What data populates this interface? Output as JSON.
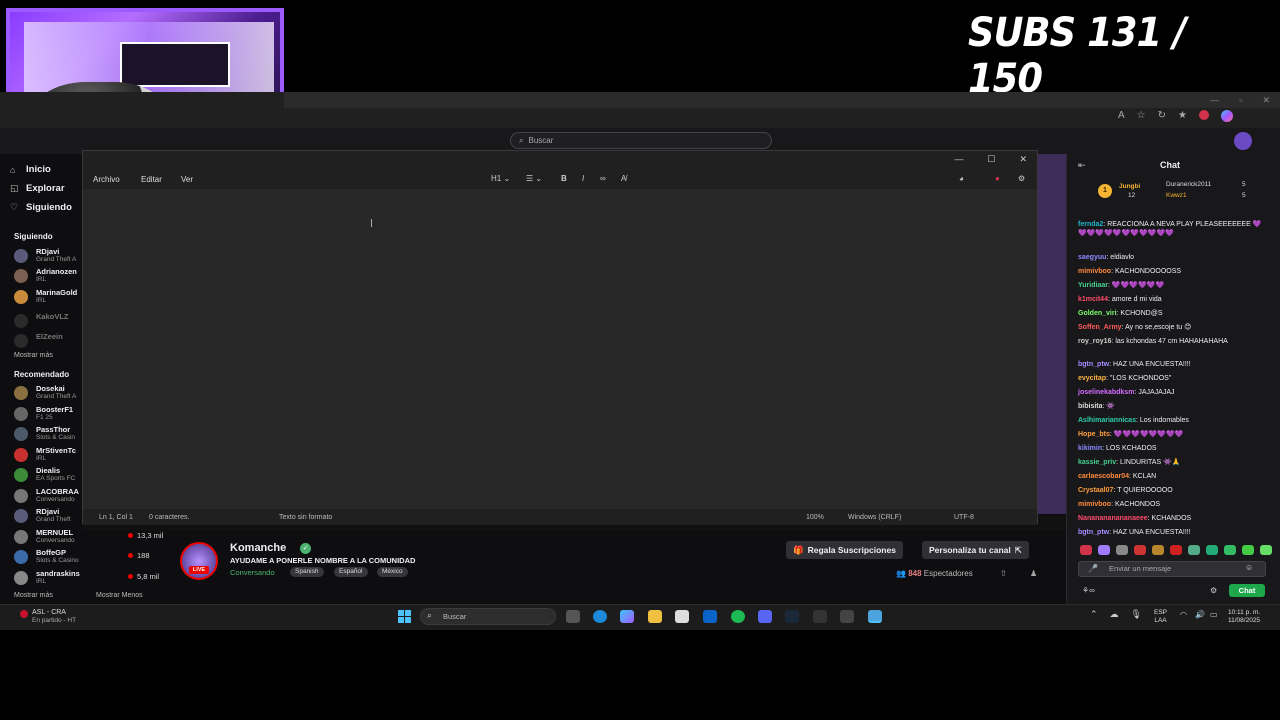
{
  "overlay": {
    "subs_counter": "SUBS 131 / 150"
  },
  "twitch": {
    "search_placeholder": "Buscar",
    "nav": {
      "inicio": "Inicio",
      "explorar": "Explorar",
      "siguiendo": "Siguiendo"
    },
    "following_title": "Siguiendo",
    "following": [
      {
        "name": "RDjavi",
        "game": "Grand Theft A"
      },
      {
        "name": "Adrianozen",
        "game": "IRL"
      },
      {
        "name": "MarinaGold",
        "game": "IRL"
      },
      {
        "name": "KakoVLZ",
        "game": ""
      },
      {
        "name": "ElZeein",
        "game": ""
      }
    ],
    "show_more_1": "Mostrar más",
    "recommended_title": "Recomendado",
    "recommended": [
      {
        "name": "Dosekai",
        "game": "Grand Theft A"
      },
      {
        "name": "BoosterF1",
        "game": "F1 25"
      },
      {
        "name": "PassThor",
        "game": "Slots & Casin"
      },
      {
        "name": "MrStivenTc",
        "game": "IRL"
      },
      {
        "name": "Diealis",
        "game": "EA Sports FC"
      },
      {
        "name": "LACOBRAA",
        "game": "Conversando"
      },
      {
        "name": "RDjavi",
        "game": "Grand Theft"
      },
      {
        "name": "MERNUEL",
        "game": "Conversando",
        "viewers": "13,3 mil"
      },
      {
        "name": "BoffeGP",
        "game": "Slots & Casino",
        "viewers": "188"
      },
      {
        "name": "sandraskins",
        "game": "IRL",
        "viewers": "5,8 mil"
      }
    ],
    "show_more_2": "Mostrar más",
    "show_less": "Mostrar Menos",
    "stream": {
      "streamer": "Komanche",
      "live": "LIVE",
      "title": "AYUDAME A PONERLE NOMBRE A LA COMUNIDAD",
      "category": "Conversando",
      "tags": [
        "Spanish",
        "Español",
        "México"
      ],
      "gift_button": "Regala Suscripciones",
      "customize_button": "Personaliza tu canal",
      "viewers_count": "848",
      "viewers_label": "Espectadores"
    },
    "chat": {
      "title": "Chat",
      "hype": {
        "rank": "1",
        "top_user": "Jungbi",
        "top_count": "12",
        "user2": "Duranerick2011",
        "user2_count": "5",
        "user3": "Kwwz1",
        "user3_count": "5"
      },
      "messages": [
        {
          "user": "fernda2",
          "color": "#1fb4c8",
          "text": "REACCIONA A NEVA PLAY PLEASEEEEEEE 💜💜💜💜💜💜💜💜💜💜💜💜"
        },
        {
          "user": "saegyuu",
          "color": "#8a8aff",
          "text": "eldiavlo"
        },
        {
          "user": "mimivboo",
          "color": "#ff8a3d",
          "text": "KACHONDOOOOSS"
        },
        {
          "user": "Yuridiaar",
          "color": "#46d18f",
          "text": "💜💜💜💜💜💜"
        },
        {
          "user": "k1mcit44",
          "color": "#ff4a6b",
          "text": "amore d mi vida"
        },
        {
          "user": "Golden_viri",
          "color": "#7dff6b",
          "text": "KCHOND@S"
        },
        {
          "user": "Soffen_Army",
          "color": "#ff5a5a",
          "text": "Ay no se,escoje tu 😊"
        },
        {
          "user": "roy_roy16",
          "color": "#cfcfcf",
          "text": "las kchondas 47 cm HAHAHAHAHA"
        },
        {
          "user": "bgtn_ptw",
          "color": "#a68bff",
          "text": "HAZ UNA ENCUESTA!!!!"
        },
        {
          "user": "evycitap",
          "color": "#ffb347",
          "text": "\"LOS KCHONDOS\""
        },
        {
          "user": "joselinekabdksm",
          "color": "#d46bff",
          "text": "JAJAJAJAJ"
        },
        {
          "user": "bibisita",
          "color": "#dddddd",
          "text": "👾"
        },
        {
          "user": "Aslhimariannicas",
          "color": "#2ecfa8",
          "text": "Los indomables"
        },
        {
          "user": "Hope_bts",
          "color": "#ff9e3d",
          "text": "💜💜💜💜💜💜💜💜"
        },
        {
          "user": "kikimin",
          "color": "#8a8aff",
          "text": "LOS KCHADOS"
        },
        {
          "user": "kassie_priv",
          "color": "#46d18f",
          "text": "LINDURITAS 👾🙏"
        },
        {
          "user": "carlaescobar04",
          "color": "#ff8a3d",
          "text": "KCLAN"
        },
        {
          "user": "Crystaal07",
          "color": "#ff9e3d",
          "text": "T QUIEROOOOO"
        },
        {
          "user": "mimivboo",
          "color": "#ff8a3d",
          "text": "KACHONDOS"
        },
        {
          "user": "Nananananananaeee",
          "color": "#ff4a6b",
          "text": "KCHANDOS"
        },
        {
          "user": "bgtn_ptw",
          "color": "#a68bff",
          "text": "HAZ UNA ENCUESTA!!!!"
        }
      ],
      "input_placeholder": "Enviar un mensaje",
      "send_button": "Chat"
    }
  },
  "notepad": {
    "menu": [
      "Archivo",
      "Editar",
      "Ver"
    ],
    "heading_tool": "H1",
    "status": {
      "position": "Ln 1, Col 1",
      "chars": "0 caracteres.",
      "format": "Texto sin formato",
      "zoom": "100%",
      "eol": "Windows (CRLF)",
      "encoding": "UTF-8"
    }
  },
  "taskbar": {
    "widget_title": "ASL - CRA",
    "widget_sub": "En partido - HT",
    "search_placeholder": "Buscar",
    "lang_1": "ESP",
    "lang_2": "LAA",
    "time": "10:11 p. m.",
    "date": "11/08/2025"
  }
}
